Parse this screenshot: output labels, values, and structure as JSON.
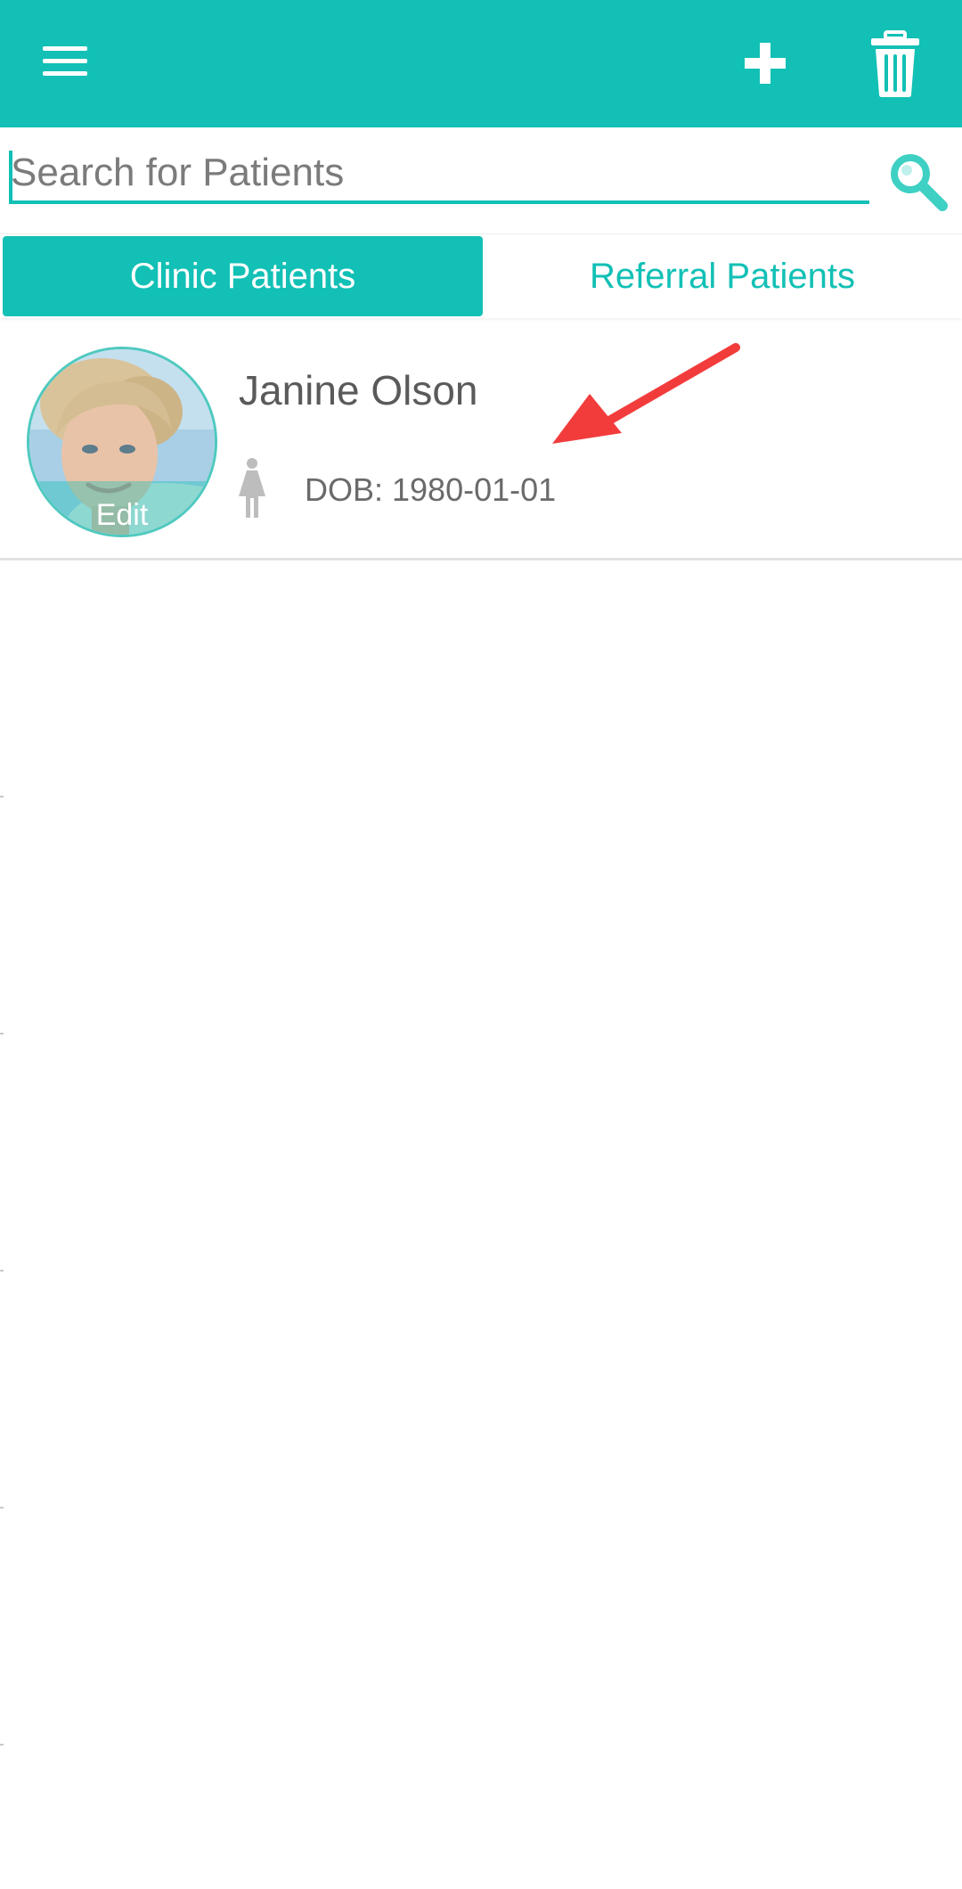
{
  "appbar": {
    "menu_icon": "hamburger-menu-icon",
    "add_icon": "plus-icon",
    "delete_icon": "trash-icon",
    "color": "#12c0b5"
  },
  "search": {
    "placeholder": "Search for Patients",
    "value": "",
    "icon": "magnifier-icon"
  },
  "tabs": [
    {
      "label": "Clinic Patients",
      "selected": true
    },
    {
      "label": "Referral Patients",
      "selected": false
    }
  ],
  "patients": [
    {
      "name": "Janine Olson",
      "dob": "DOB: 1980-01-01",
      "gender_icon": "female-icon",
      "avatar_edit_label": "Edit"
    }
  ],
  "annotation": {
    "type": "arrow",
    "color": "#f23c3c"
  },
  "colors": {
    "accent": "#12c0b5",
    "text_primary": "#5a5a5a",
    "text_secondary": "#6a6a6a",
    "divider": "#e2e2e2",
    "annotation": "#f23c3c"
  }
}
